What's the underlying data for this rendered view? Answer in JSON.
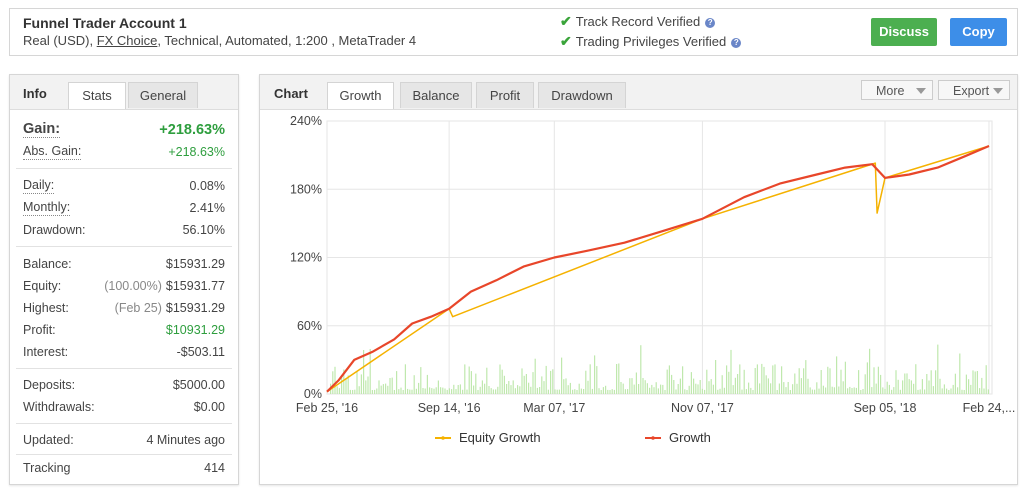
{
  "header": {
    "title": "Funnel Trader Account 1",
    "sub_prefix": "Real (USD), ",
    "broker": "FX Choice",
    "sub_suffix": ", Technical, Automated, 1:200 , MetaTrader 4",
    "track_record": "Track Record Verified",
    "trading_privileges": "Trading Privileges Verified",
    "discuss": "Discuss",
    "copy": "Copy",
    "colors": {
      "discuss": "#4caf50",
      "copy": "#3d8ee8",
      "check": "#3aa43a"
    }
  },
  "info": {
    "title": "Info",
    "tabs": [
      "Stats",
      "General"
    ],
    "gain": {
      "label": "Gain:",
      "value": "+218.63%"
    },
    "abs_gain": {
      "label": "Abs. Gain:",
      "value": "+218.63%"
    },
    "daily": {
      "label": "Daily:",
      "value": "0.08%"
    },
    "monthly": {
      "label": "Monthly:",
      "value": "2.41%"
    },
    "drawdown": {
      "label": "Drawdown:",
      "value": "56.10%"
    },
    "balance": {
      "label": "Balance:",
      "value": "$15931.29"
    },
    "equity": {
      "label": "Equity:",
      "note": "(100.00%)",
      "value": "$15931.77"
    },
    "highest": {
      "label": "Highest:",
      "note": "(Feb 25)",
      "value": "$15931.29"
    },
    "profit": {
      "label": "Profit:",
      "value": "$10931.29"
    },
    "interest": {
      "label": "Interest:",
      "value": "-$503.11"
    },
    "deposits": {
      "label": "Deposits:",
      "value": "$5000.00"
    },
    "withdrawals": {
      "label": "Withdrawals:",
      "value": "$0.00"
    },
    "updated": {
      "label": "Updated:",
      "value": "4 Minutes ago"
    },
    "tracking": {
      "label": "Tracking",
      "value": "414"
    }
  },
  "chart_panel": {
    "title": "Chart",
    "tabs": [
      "Growth",
      "Balance",
      "Profit",
      "Drawdown"
    ],
    "more": "More",
    "export": "Export"
  },
  "chart_data": {
    "type": "line",
    "ylim": [
      0,
      240
    ],
    "y_ticks": [
      0,
      60,
      120,
      180,
      240
    ],
    "y_tick_labels": [
      "0%",
      "60%",
      "120%",
      "180%",
      "240%"
    ],
    "x_tick_labels": [
      "Feb 25, '16",
      "Sep 14, '16",
      "Mar 07, '17",
      "Nov 07, '17",
      "Sep 05, '18",
      "Feb 24,..."
    ],
    "x_tick_dates": [
      "2016-02-25",
      "2016-09-14",
      "2017-03-07",
      "2017-11-07",
      "2018-09-05",
      "2019-02-24"
    ],
    "grid": true,
    "legend_position": "bottom",
    "series": [
      {
        "name": "Growth",
        "color": "#e8462a",
        "x": [
          "2016-02-25",
          "2016-03-15",
          "2016-04-10",
          "2016-05-10",
          "2016-06-15",
          "2016-07-15",
          "2016-08-15",
          "2016-09-14",
          "2016-10-20",
          "2016-12-01",
          "2017-01-15",
          "2017-03-07",
          "2017-05-01",
          "2017-07-01",
          "2017-09-01",
          "2017-11-07",
          "2018-01-15",
          "2018-03-15",
          "2018-05-15",
          "2018-07-01",
          "2018-08-15",
          "2018-09-05",
          "2018-10-15",
          "2018-12-01",
          "2019-01-15",
          "2019-02-24"
        ],
        "values": [
          2,
          12,
          30,
          37,
          48,
          62,
          68,
          75,
          90,
          100,
          112,
          120,
          126,
          133,
          143,
          154,
          173,
          185,
          193,
          199,
          202,
          190,
          193,
          199,
          209,
          218
        ]
      },
      {
        "name": "Equity Growth",
        "color": "#f5b200",
        "x": [
          "2016-02-25",
          "2016-09-14",
          "2016-09-20",
          "2017-11-07",
          "2018-08-20",
          "2018-08-23",
          "2018-09-05",
          "2019-02-24"
        ],
        "values": [
          2,
          75,
          68,
          154,
          203,
          159,
          190,
          218
        ]
      }
    ],
    "volume_bars_color": "#bfe8ad"
  }
}
